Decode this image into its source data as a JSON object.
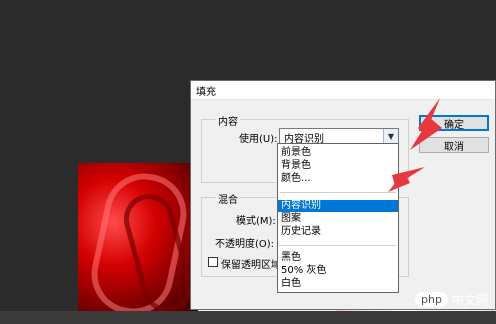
{
  "dialog": {
    "title": "填充",
    "content_group": {
      "legend": "内容",
      "use_label": "使用(U):",
      "use_value": "内容识别"
    },
    "blend_group": {
      "legend": "混合",
      "mode_label": "模式(M):",
      "opacity_label": "不透明度(O):",
      "preserve_label": "保留透明区域"
    },
    "ok_label": "确定",
    "cancel_label": "取消"
  },
  "dropdown": {
    "group1": [
      "前景色",
      "背景色",
      "颜色..."
    ],
    "group2": [
      "内容识别",
      "图案",
      "历史记录"
    ],
    "group3": [
      "黑色",
      "50% 灰色",
      "白色"
    ],
    "selected": "内容识别"
  },
  "watermark": {
    "logo": "php",
    "text": "中文网"
  },
  "colors": {
    "accent": "#0078d7",
    "arrow": "#e8383d"
  },
  "icons": {
    "dropdown_arrow": "chevron-down-icon"
  }
}
